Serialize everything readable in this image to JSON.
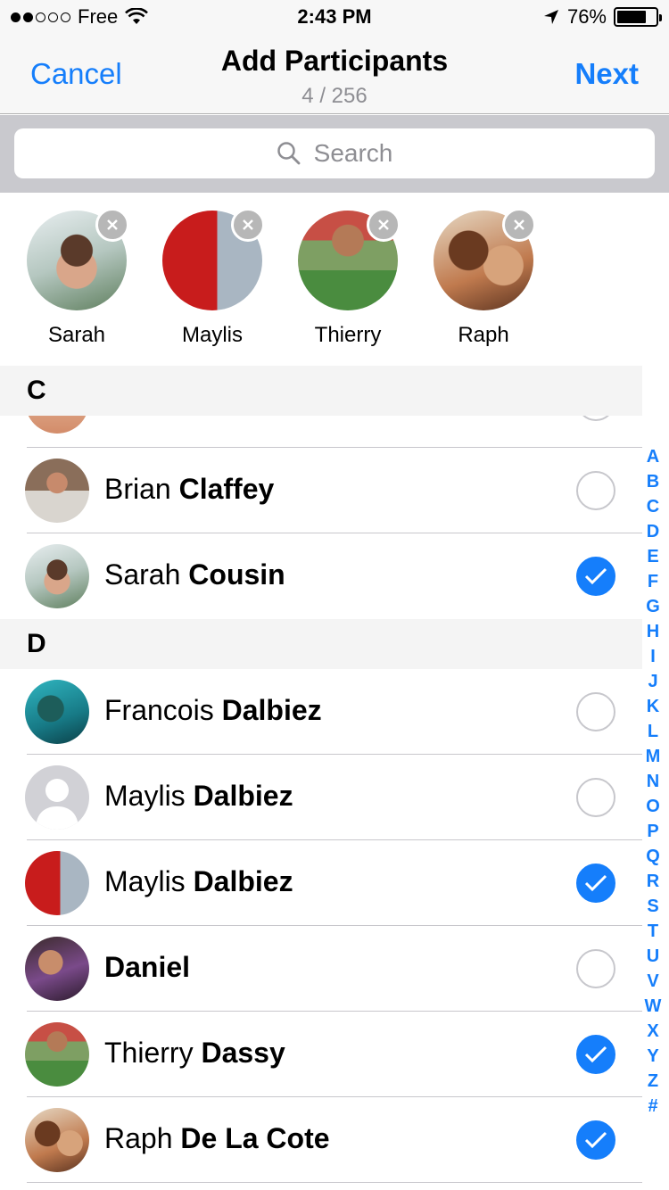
{
  "status_bar": {
    "carrier": "Free",
    "time": "2:43 PM",
    "battery": "76%",
    "battery_level": 0.76,
    "signal_bars_on": 2,
    "signal_bars_total": 5
  },
  "nav": {
    "cancel": "Cancel",
    "title": "Add Participants",
    "subtitle": "4 / 256",
    "next": "Next"
  },
  "search": {
    "placeholder": "Search"
  },
  "selected": [
    {
      "name": "Sarah"
    },
    {
      "name": "Maylis"
    },
    {
      "name": "Thierry"
    },
    {
      "name": "Raph"
    }
  ],
  "sections": {
    "c": "C",
    "d": "D"
  },
  "contacts": {
    "brian": {
      "first": "Brian",
      "last": "Claffey",
      "checked": false
    },
    "sarah": {
      "first": "Sarah",
      "last": "Cousin",
      "checked": true
    },
    "francois": {
      "first": "Francois",
      "last": "Dalbiez",
      "checked": false
    },
    "maylis1": {
      "first": "Maylis",
      "last": "Dalbiez",
      "checked": false
    },
    "maylis2": {
      "first": "Maylis",
      "last": "Dalbiez",
      "checked": true
    },
    "daniel": {
      "first": "",
      "last": "Daniel",
      "checked": false
    },
    "thierry": {
      "first": "Thierry",
      "last": "Dassy",
      "checked": true
    },
    "raph": {
      "first": "Raph",
      "last": "De La Cote",
      "checked": true
    }
  },
  "index": [
    "A",
    "B",
    "C",
    "D",
    "E",
    "F",
    "G",
    "H",
    "I",
    "J",
    "K",
    "L",
    "M",
    "N",
    "O",
    "P",
    "Q",
    "R",
    "S",
    "T",
    "U",
    "V",
    "W",
    "X",
    "Y",
    "Z",
    "#"
  ],
  "colors": {
    "accent": "#157efb",
    "nav_bg": "#f7f7f7",
    "search_bg": "#c9c9ce",
    "section_bg": "#f4f4f4"
  }
}
